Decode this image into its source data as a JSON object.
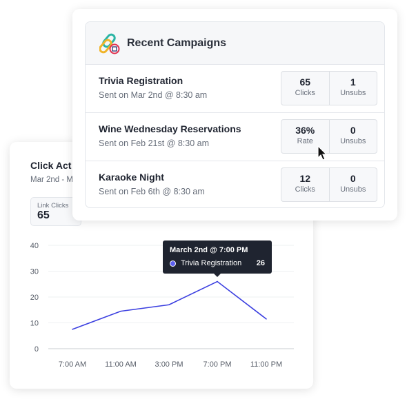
{
  "activity": {
    "title": "Click Act",
    "date_range": "Mar 2nd - M",
    "kpi_label": "Link Clicks",
    "kpi_value": "65"
  },
  "campaigns": {
    "title": "Recent Campaigns",
    "icon": "chain-link-icon",
    "rows": [
      {
        "name": "Trivia Registration",
        "sent": "Sent on Mar 2nd @ 8:30 am",
        "s1v": "65",
        "s1l": "Clicks",
        "s2v": "1",
        "s2l": "Unsubs"
      },
      {
        "name": "Wine Wednesday Reservations",
        "sent": "Sent on Feb 21st @ 8:30 am",
        "s1v": "36%",
        "s1l": "Rate",
        "s2v": "0",
        "s2l": "Unsubs"
      },
      {
        "name": "Karaoke Night",
        "sent": "Sent on Feb 6th @ 8:30 am",
        "s1v": "12",
        "s1l": "Clicks",
        "s2v": "0",
        "s2l": "Unsubs"
      }
    ]
  },
  "tooltip": {
    "title": "March 2nd @ 7:00 PM",
    "series": "Trivia Registration",
    "value": "26"
  },
  "chart_data": {
    "type": "line",
    "categories": [
      "7:00 AM",
      "11:00 AM",
      "3:00 PM",
      "7:00 PM",
      "11:00 PM"
    ],
    "yticks": [
      "0",
      "10",
      "20",
      "30",
      "40"
    ],
    "ylim": [
      0,
      40
    ],
    "grid": true,
    "series": [
      {
        "name": "Trivia Registration",
        "values": [
          7.5,
          14.5,
          17,
          26,
          11.5
        ],
        "color": "#3b3fe0"
      }
    ]
  }
}
